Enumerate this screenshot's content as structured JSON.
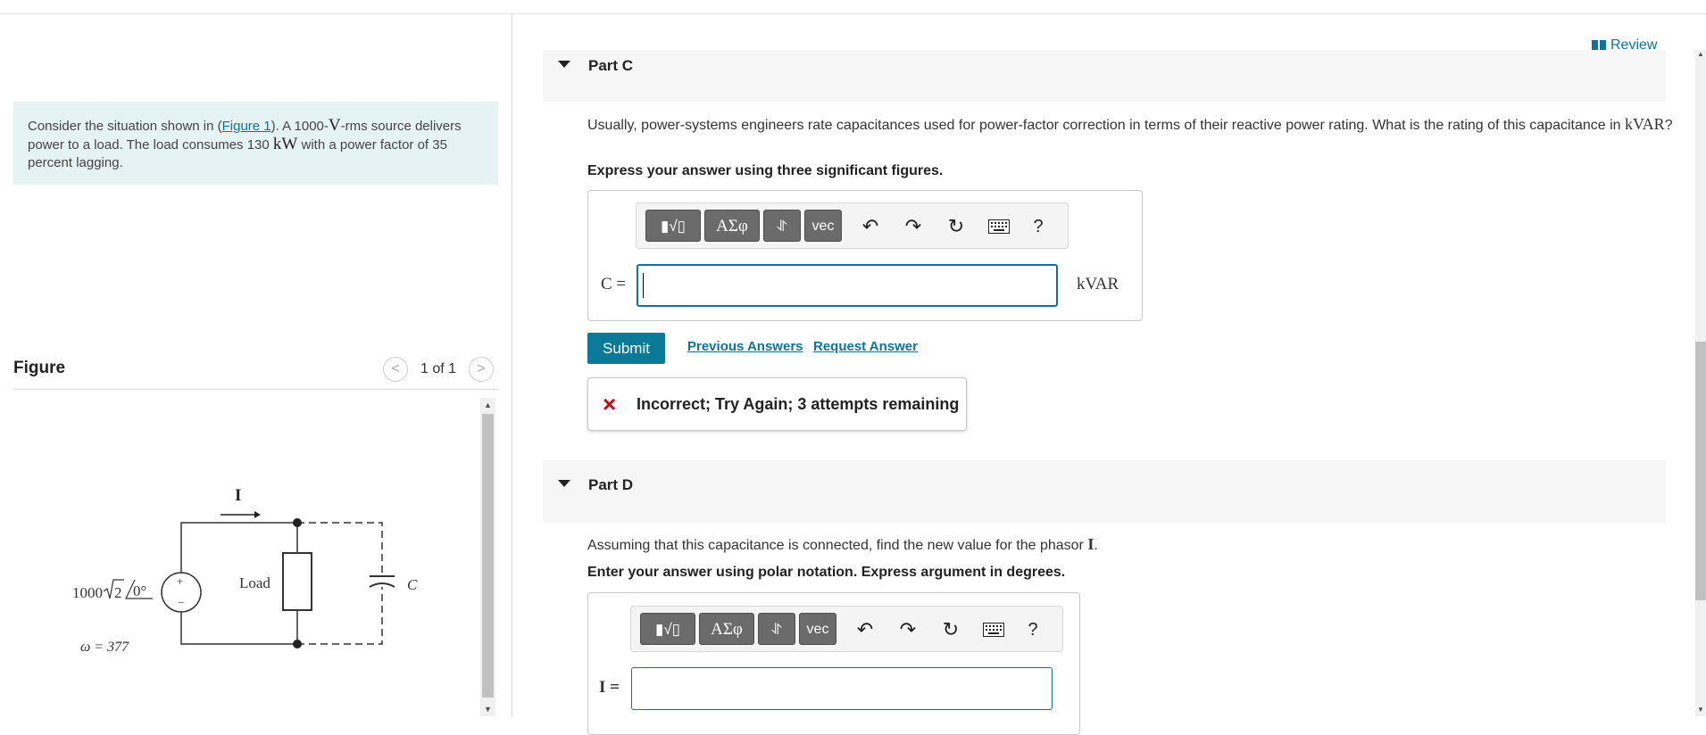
{
  "intro": {
    "t1": "Consider the situation shown in (",
    "figure_link": "Figure 1",
    "t2": "). A 1000-",
    "v_symbol": "V",
    "t3": "-rms source delivers power to a load. The load consumes 130 ",
    "kw_symbol": "kW",
    "t4": " with a power factor of 35 percent lagging."
  },
  "figure": {
    "title": "Figure",
    "prev_icon": "chevron-left-icon",
    "next_icon": "chevron-right-icon",
    "pager": "1 of 1",
    "circuit": {
      "current_label": "I",
      "source_value": "1000",
      "source_sqrt": "2",
      "source_angle": "0°",
      "omega": "ω = 377",
      "load_label": "Load",
      "cap_label": "C",
      "plus": "+",
      "minus": "−"
    }
  },
  "review": {
    "label": "Review",
    "icon": "book-icon"
  },
  "partC": {
    "label": "Part C",
    "q1": "Usually, power-systems engineers rate capacitances used for power-factor correction in terms of their reactive power rating. What is the rating of this capacitance in ",
    "q1_unit": "kVAR",
    "q1_end": "?",
    "instruction": "Express your answer using three significant figures.",
    "toolbar": {
      "templates": "▮√▯",
      "greek": "ΑΣφ",
      "arrows": "⥯",
      "vec": "vec",
      "undo_icon": "undo-icon",
      "redo_icon": "redo-icon",
      "reset_icon": "reset-icon",
      "keyboard_icon": "keyboard-icon",
      "help": "?"
    },
    "eq_label": "C =",
    "unit": "kVAR",
    "submit": "Submit",
    "previous_answers": "Previous Answers",
    "request_answer": "Request Answer",
    "feedback": "Incorrect; Try Again; 3 attempts remaining",
    "feedback_icon": "×"
  },
  "partD": {
    "label": "Part D",
    "q1": "Assuming that this capacitance is connected, find the new value for the phasor ",
    "q1_sym": "I",
    "q1_end": ".",
    "instruction": "Enter your answer using polar notation. Express argument in degrees.",
    "toolbar": {
      "templates": "▮√▯",
      "greek": "ΑΣφ",
      "arrows": "⥯",
      "vec": "vec",
      "help": "?"
    },
    "eq_label": "I ="
  },
  "colors": {
    "link": "#0b73a3",
    "submit_bg": "#0b7a99",
    "intro_bg": "#e6f3f5",
    "error": "#d0021b"
  }
}
